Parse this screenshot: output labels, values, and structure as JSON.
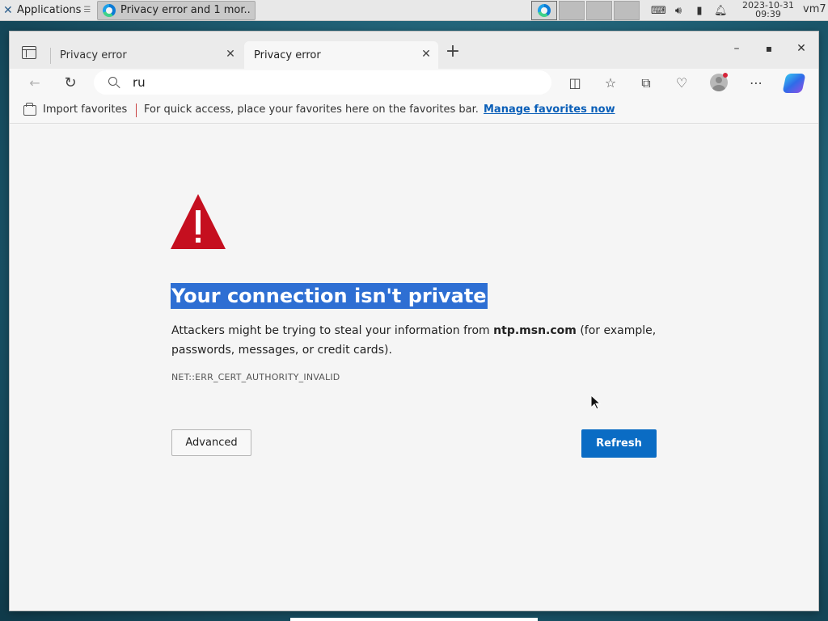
{
  "taskbar": {
    "apps_label": "Applications",
    "window_title": "Privacy error and 1 mor...",
    "date": "2023-10-31",
    "time": "09:39",
    "hostname": "vm7"
  },
  "browser": {
    "tabs": [
      {
        "label": "Privacy error",
        "active": false
      },
      {
        "label": "Privacy error",
        "active": true
      }
    ],
    "address": {
      "value": "ru"
    },
    "favorites_bar": {
      "import_label": "Import favorites",
      "hint": "For quick access, place your favorites here on the favorites bar.",
      "link": "Manage favorites now"
    }
  },
  "page": {
    "title": "Your connection isn't private",
    "desc_prefix": "Attackers might be trying to steal your information from ",
    "domain": "ntp.msn.com",
    "desc_suffix": " (for example, passwords, messages, or credit cards).",
    "error_code": "NET::ERR_CERT_AUTHORITY_INVALID",
    "advanced_label": "Advanced",
    "refresh_label": "Refresh"
  },
  "colors": {
    "accent": "#0a6cc4",
    "warning": "#c50f1f",
    "selection": "#2e6fd3",
    "link": "#0b5fb8"
  }
}
